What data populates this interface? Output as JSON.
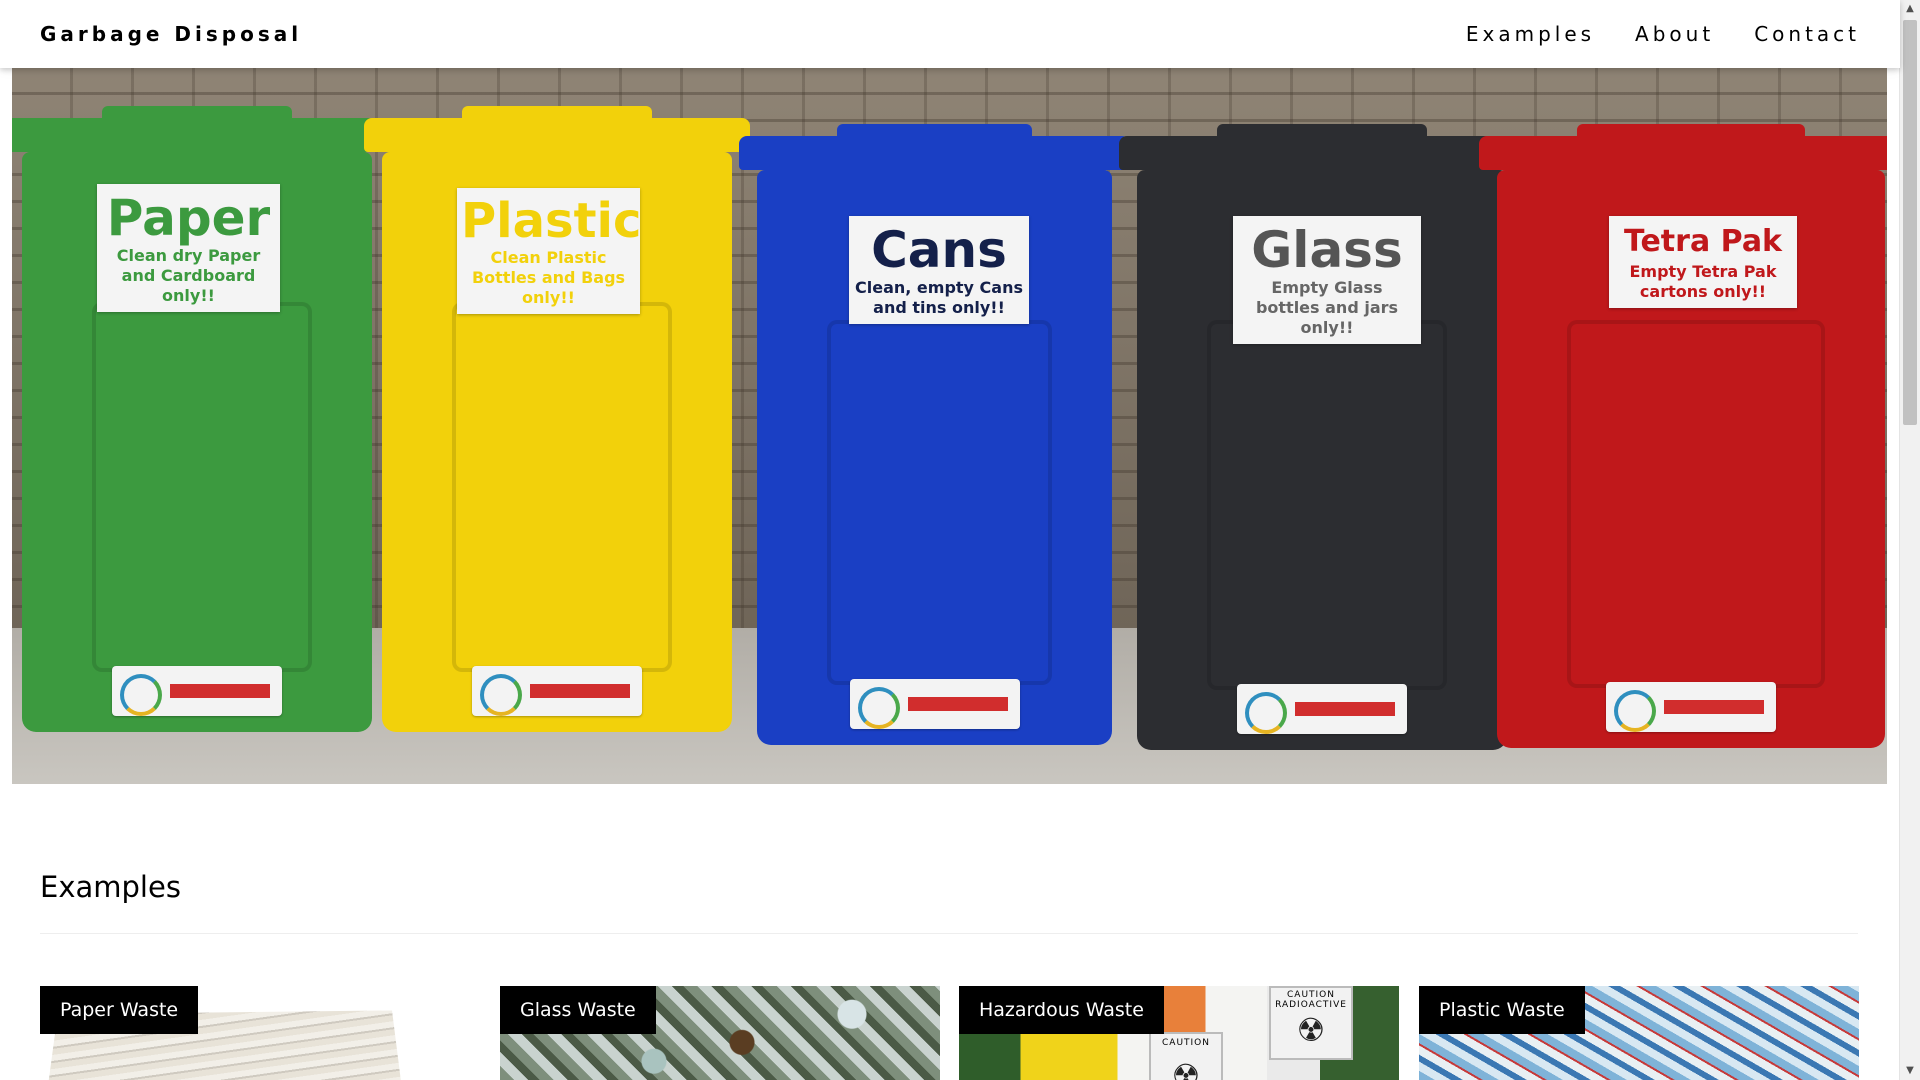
{
  "brand": "Garbage Disposal",
  "nav": {
    "links": [
      "Examples",
      "About",
      "Contact"
    ]
  },
  "hero": {
    "bins": [
      {
        "color": "#3c9a3f",
        "title": "Paper",
        "text": "Clean dry Paper and Cardboard only!!"
      },
      {
        "color": "#f2d10b",
        "title": "Plastic",
        "text": "Clean Plastic Bottles and Bags only!!"
      },
      {
        "color": "#1a3fc4",
        "title": "Cans",
        "text": "Clean, empty Cans and tins only!!"
      },
      {
        "color": "#2c2d31",
        "title": "Glass",
        "text": "Empty Glass bottles and jars only!!"
      },
      {
        "color": "#c0181b",
        "title": "Tetra Pak",
        "text": "Empty Tetra Pak cartons only!!"
      }
    ]
  },
  "examples": {
    "title": "Examples",
    "cards": [
      {
        "label": "Paper Waste"
      },
      {
        "label": "Glass Waste"
      },
      {
        "label": "Hazardous Waste",
        "badges": [
          "CAUTION",
          "CAUTION RADIOACTIVE"
        ]
      },
      {
        "label": "Plastic Waste"
      }
    ]
  }
}
